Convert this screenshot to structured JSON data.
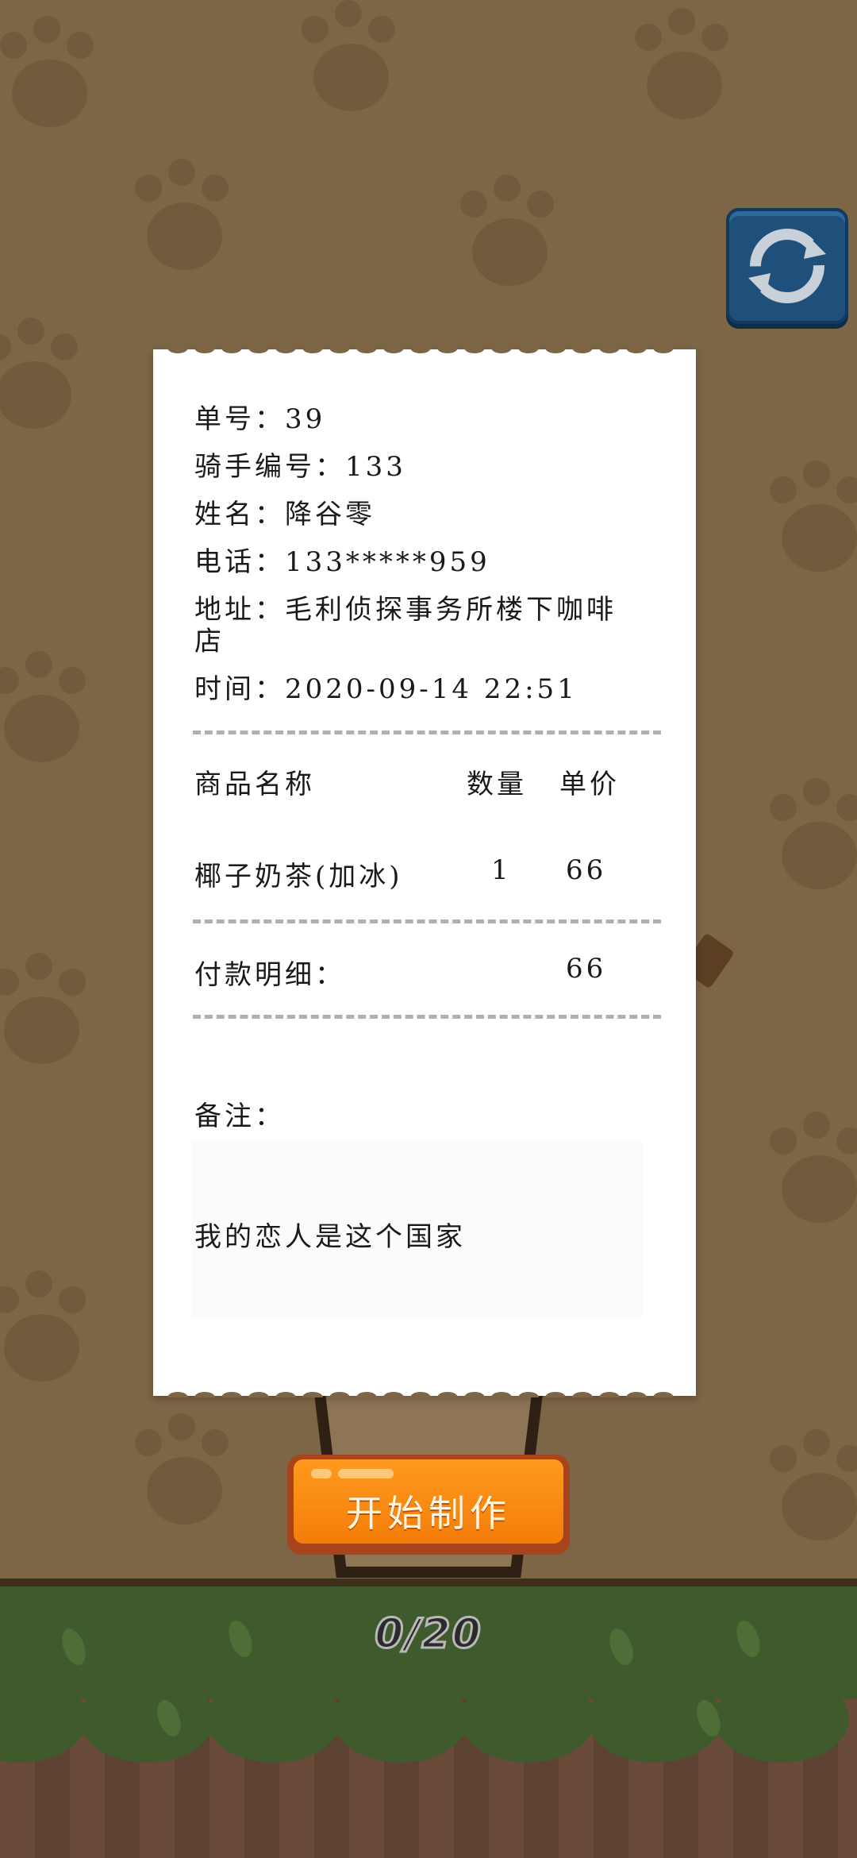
{
  "receipt": {
    "order_no": "单号：39",
    "rider_no": "骑手编号：133",
    "name": "姓名：降谷零",
    "phone": "电话：133*****959",
    "address_line1": "地址：毛利侦探事务所楼下咖啡",
    "address_line2": "店",
    "time": "时间：2020-09-14 22:51",
    "headers": {
      "item": "商品名称",
      "qty": "数量",
      "price": "单价"
    },
    "items": [
      {
        "name": "椰子奶茶(加冰)",
        "qty": "1",
        "price": "66"
      }
    ],
    "payment_label": "付款明细：",
    "payment_total": "66",
    "remark_label": "备注：",
    "remark_text": "我的恋人是这个国家"
  },
  "buttons": {
    "start": "开始制作",
    "refresh_icon": "refresh-icon"
  },
  "progress": {
    "text": "0/20",
    "done": 0,
    "total": 20
  },
  "colors": {
    "background": "#7d6646",
    "button_orange": "#f47d0a",
    "refresh_blue": "#1f4f7b",
    "grass": "#3f5a2c"
  }
}
